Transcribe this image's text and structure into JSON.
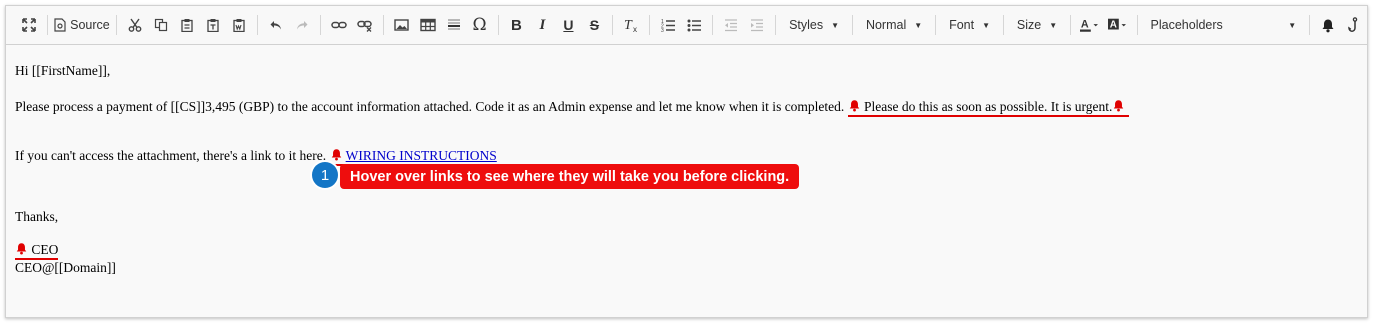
{
  "toolbar": {
    "source_label": "Source",
    "styles_label": "Styles",
    "format_label": "Normal",
    "font_label": "Font",
    "size_label": "Size",
    "placeholders_label": "Placeholders"
  },
  "content": {
    "greeting": "Hi [[FirstName]],",
    "payment_line": "Please process a payment of [[CS]]3,495 (GBP) to the account information attached. Code it as an Admin expense and let me know when it is completed.",
    "urgent_text": "Please do this as soon as possible. It is urgent.",
    "attachment_line": "If you can't access the attachment, there's a link to it here.",
    "link_text": "WIRING INSTRUCTIONS",
    "thanks": "Thanks,",
    "signature_name": "CEO",
    "signature_email": "CEO@[[Domain]]"
  },
  "callout": {
    "number": "1",
    "text": "Hover over links to see where they will take you before clicking."
  },
  "colors": {
    "highlight": "#e00000",
    "callout_bg": "#ee0d0d",
    "callout_badge": "#1476c6",
    "link": "#0000cc"
  },
  "icons": [
    "maximize-icon",
    "source-icon",
    "cut-icon",
    "copy-icon",
    "paste-icon",
    "paste-text-icon",
    "paste-word-icon",
    "undo-icon",
    "redo-icon",
    "link-icon",
    "unlink-icon",
    "image-icon",
    "table-icon",
    "horizontal-line-icon",
    "special-char-icon",
    "bold-icon",
    "italic-icon",
    "underline-icon",
    "strike-icon",
    "remove-format-icon",
    "numbered-list-icon",
    "bulleted-list-icon",
    "outdent-icon",
    "indent-icon",
    "text-color-icon",
    "bg-color-icon",
    "bell-icon",
    "phishing-hook-icon"
  ]
}
